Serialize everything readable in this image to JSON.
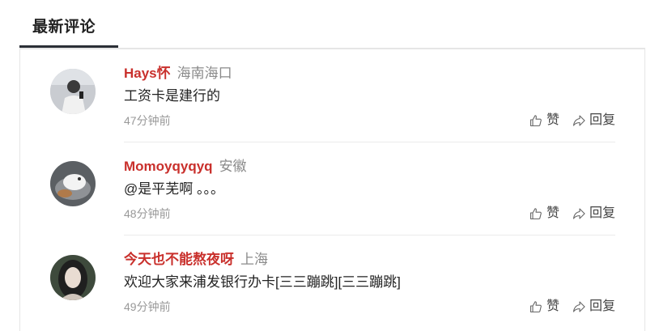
{
  "section": {
    "title": "最新评论"
  },
  "colors": {
    "username": "#c9302c",
    "location": "#8a8a8a",
    "time": "#999999",
    "tab_underline": "#2b2f36"
  },
  "comments": [
    {
      "username": "Hays怀",
      "location": "海南海口",
      "text": "工资卡是建行的",
      "time": "47分钟前",
      "like_label": "赞",
      "reply_label": "回复",
      "like_icon": "thumbs-up-icon",
      "reply_icon": "reply-arrow-icon"
    },
    {
      "username": "Momoyqyqyq",
      "location": "安徽",
      "text": "@是平芜啊 。。。",
      "time": "48分钟前",
      "like_label": "赞",
      "reply_label": "回复",
      "like_icon": "thumbs-up-icon",
      "reply_icon": "reply-arrow-icon"
    },
    {
      "username": "今天也不能熬夜呀",
      "location": "上海",
      "text": "欢迎大家来浦发银行办卡[三三蹦跳][三三蹦跳]",
      "time": "49分钟前",
      "like_label": "赞",
      "reply_label": "回复",
      "like_icon": "thumbs-up-icon",
      "reply_icon": "reply-arrow-icon"
    }
  ]
}
